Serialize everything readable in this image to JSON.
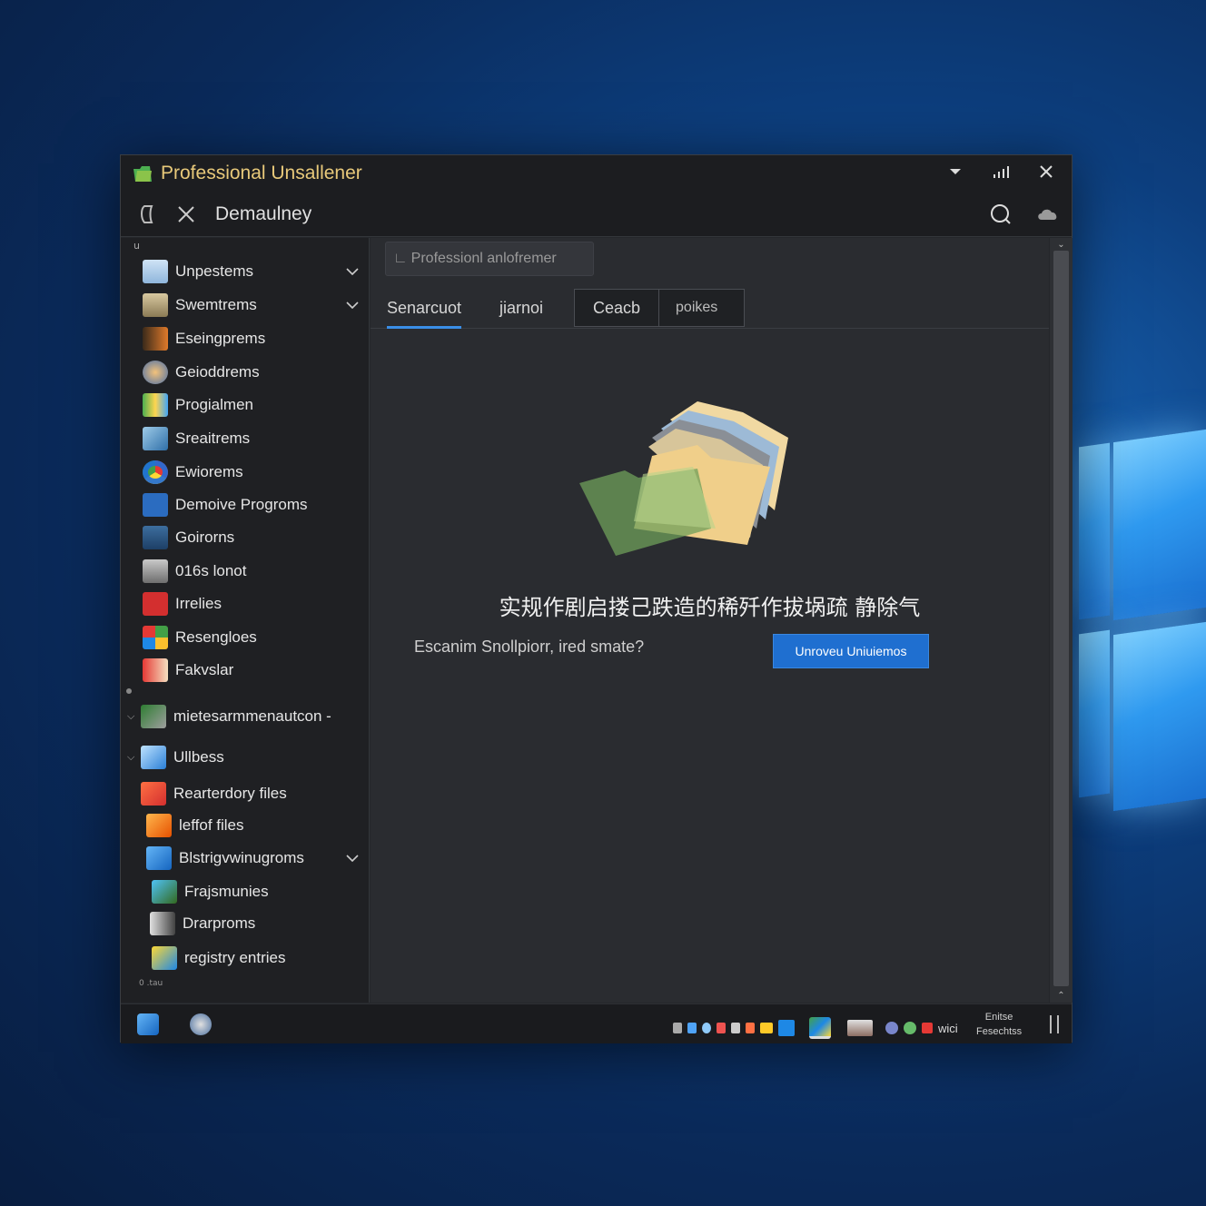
{
  "window": {
    "title": "Professional Unsallener",
    "toolbar_title": "Demaulney"
  },
  "sidebar": {
    "top_label": "u",
    "items": [
      {
        "label": "Unpestems"
      },
      {
        "label": "Swemtrems"
      },
      {
        "label": "Eseingprems"
      },
      {
        "label": "Geioddrems"
      },
      {
        "label": "Progialmen"
      },
      {
        "label": "Sreaitrems"
      },
      {
        "label": "Ewiorems"
      },
      {
        "label": "Demoive Progroms"
      },
      {
        "label": "Goirorns"
      },
      {
        "label": "016s lonot"
      },
      {
        "label": "Irrelies"
      },
      {
        "label": "Resengloes"
      },
      {
        "label": "Fakvslar"
      }
    ],
    "section1": "mietesarmmenautcon -",
    "section2": "Ullbess",
    "files": [
      {
        "label": "Rearterdory files"
      },
      {
        "label": "leffof files"
      },
      {
        "label": "Blstrigvwinugroms"
      },
      {
        "label": "Frajsmunies"
      },
      {
        "label": "Drarproms"
      },
      {
        "label": "registry entries"
      }
    ],
    "bottom_label": "0 .tau"
  },
  "main": {
    "breadcrumb": "Professionl anlofremer",
    "tabs": [
      "Senarcuot",
      "jiarnoi",
      "Ceacb",
      "poikes"
    ],
    "headline": "实规作剧启搂己跌造的稀歼作拔埚疏 静除气",
    "question": "Escanim Snollpiorr, ired smate?",
    "primary_button": "Unroveu Uniuiemos"
  },
  "taskbar": {
    "tray_text": "wici",
    "clock_line1": "Enitse",
    "clock_line2": "Fesechtss"
  },
  "colors": {
    "accent": "#1f6fd0",
    "title_text": "#e8c97a",
    "window_bg": "#25272b"
  }
}
